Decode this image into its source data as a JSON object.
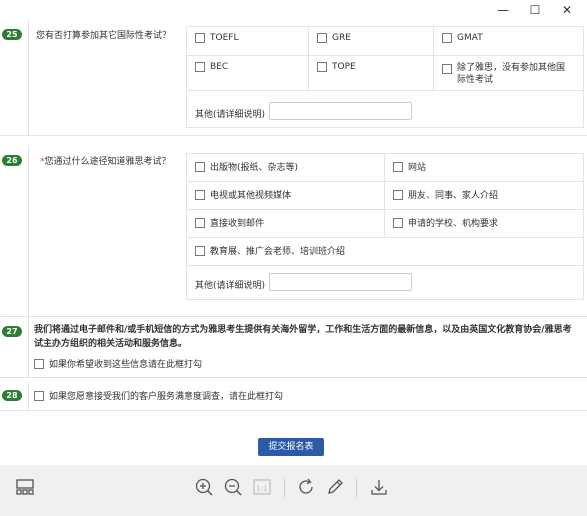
{
  "window": {
    "minimize": "—",
    "maximize": "☐",
    "close": "✕"
  },
  "q25": {
    "num": "25",
    "text": "您有否打算参加其它国际性考试？",
    "options": [
      "TOEFL",
      "GRE",
      "GMAT",
      "BEC",
      "TOPE",
      "除了雅思，没有参加其他国际性考试"
    ],
    "other_label": "其他(请详细说明)"
  },
  "q26": {
    "num": "26",
    "required": "*",
    "text": "您通过什么途径知道雅思考试？",
    "options": [
      "出版物(报纸、杂志等)",
      "网站",
      "电视或其他视频媒体",
      "朋友、同事、家人介绍",
      "直接收到邮件",
      "申请的学校、机构要求",
      "教育展、推广会老师、培训班介绍"
    ],
    "other_label": "其他(请详细说明)"
  },
  "q27": {
    "num": "27",
    "text": "我们将通过电子邮件和/或手机短信的方式为雅思考生提供有关海外留学，工作和生活方面的最新信息，以及由英国文化教育协会/雅思考试主办方组织的相关活动和服务信息。",
    "checkbox_label": "如果你希望收到这些信息请在此框打勾"
  },
  "q28": {
    "num": "28",
    "checkbox_label": "如果您愿意接受我们的客户服务满意度调查，请在此框打勾"
  },
  "submit_label": "提交报名表",
  "toolbar": {
    "page_box": "1:1"
  }
}
